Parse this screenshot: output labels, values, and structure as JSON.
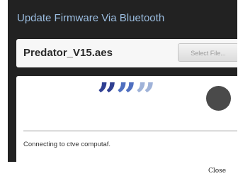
{
  "dialog": {
    "title": "Update Firmware Via Bluetooth",
    "background_color": "#222222",
    "title_color": "#9bbde0"
  },
  "file_row": {
    "file_name": "Predator_V15.aes",
    "select_button_label": "Select File..."
  },
  "progress": {
    "spinner_glyph": "”",
    "spinner_colors": [
      "#2f3f92",
      "#4f6fc0",
      "#9fb2d8"
    ],
    "status_indicator_color": "#4a4a4a",
    "status_text": "Connecting  to ctve computaf."
  },
  "footer": {
    "close_label": "Close"
  }
}
